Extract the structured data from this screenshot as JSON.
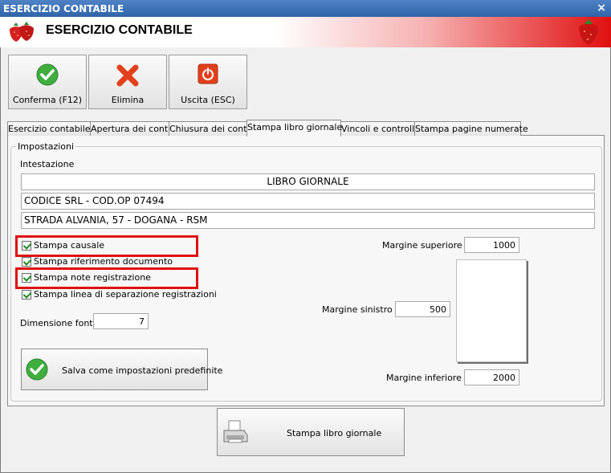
{
  "window": {
    "title": "ESERCIZIO CONTABILE",
    "close_glyph": "×"
  },
  "header": {
    "title": "ESERCIZIO CONTABILE",
    "icon": "strawberry-icon"
  },
  "toolbar": {
    "confirm_label": "Conferma (F12)",
    "delete_label": "Elimina",
    "exit_label": "Uscita (ESC)"
  },
  "tabs": [
    {
      "label": "Esercizio contabile"
    },
    {
      "label": "Apertura dei conti"
    },
    {
      "label": "Chiusura dei conti"
    },
    {
      "label": "Stampa libro giornale",
      "active": true
    },
    {
      "label": "Vincoli e controlli"
    },
    {
      "label": "Stampa pagine numerate"
    }
  ],
  "settings": {
    "group_label": "Impostazioni",
    "heading_label": "Intestazione",
    "heading_lines": [
      "LIBRO GIORNALE",
      "CODICE SRL - COD.OP 07494",
      "STRADA ALVANIA, 57 - DOGANA - RSM"
    ],
    "checkboxes": [
      {
        "label": "Stampa causale",
        "checked": true
      },
      {
        "label": "Stampa riferimento documento",
        "checked": true
      },
      {
        "label": "Stampa note registrazione",
        "checked": true
      },
      {
        "label": "Stampa linea di separazione registrazioni",
        "checked": true
      }
    ],
    "font_size_label": "Dimensione font :",
    "font_size_value": "7",
    "save_defaults_label": "Salva come impostazioni predefinite",
    "margin_top_label": "Margine superiore :",
    "margin_top_value": "1000",
    "margin_left_label": "Margine sinistro :",
    "margin_left_value": "500",
    "margin_bottom_label": "Margine inferiore :",
    "margin_bottom_value": "2000"
  },
  "print_button_label": "Stampa libro giornale",
  "colors": {
    "highlight": "#e01010",
    "title_bar": "#3a6fb3",
    "check": "#1c8a1c"
  }
}
